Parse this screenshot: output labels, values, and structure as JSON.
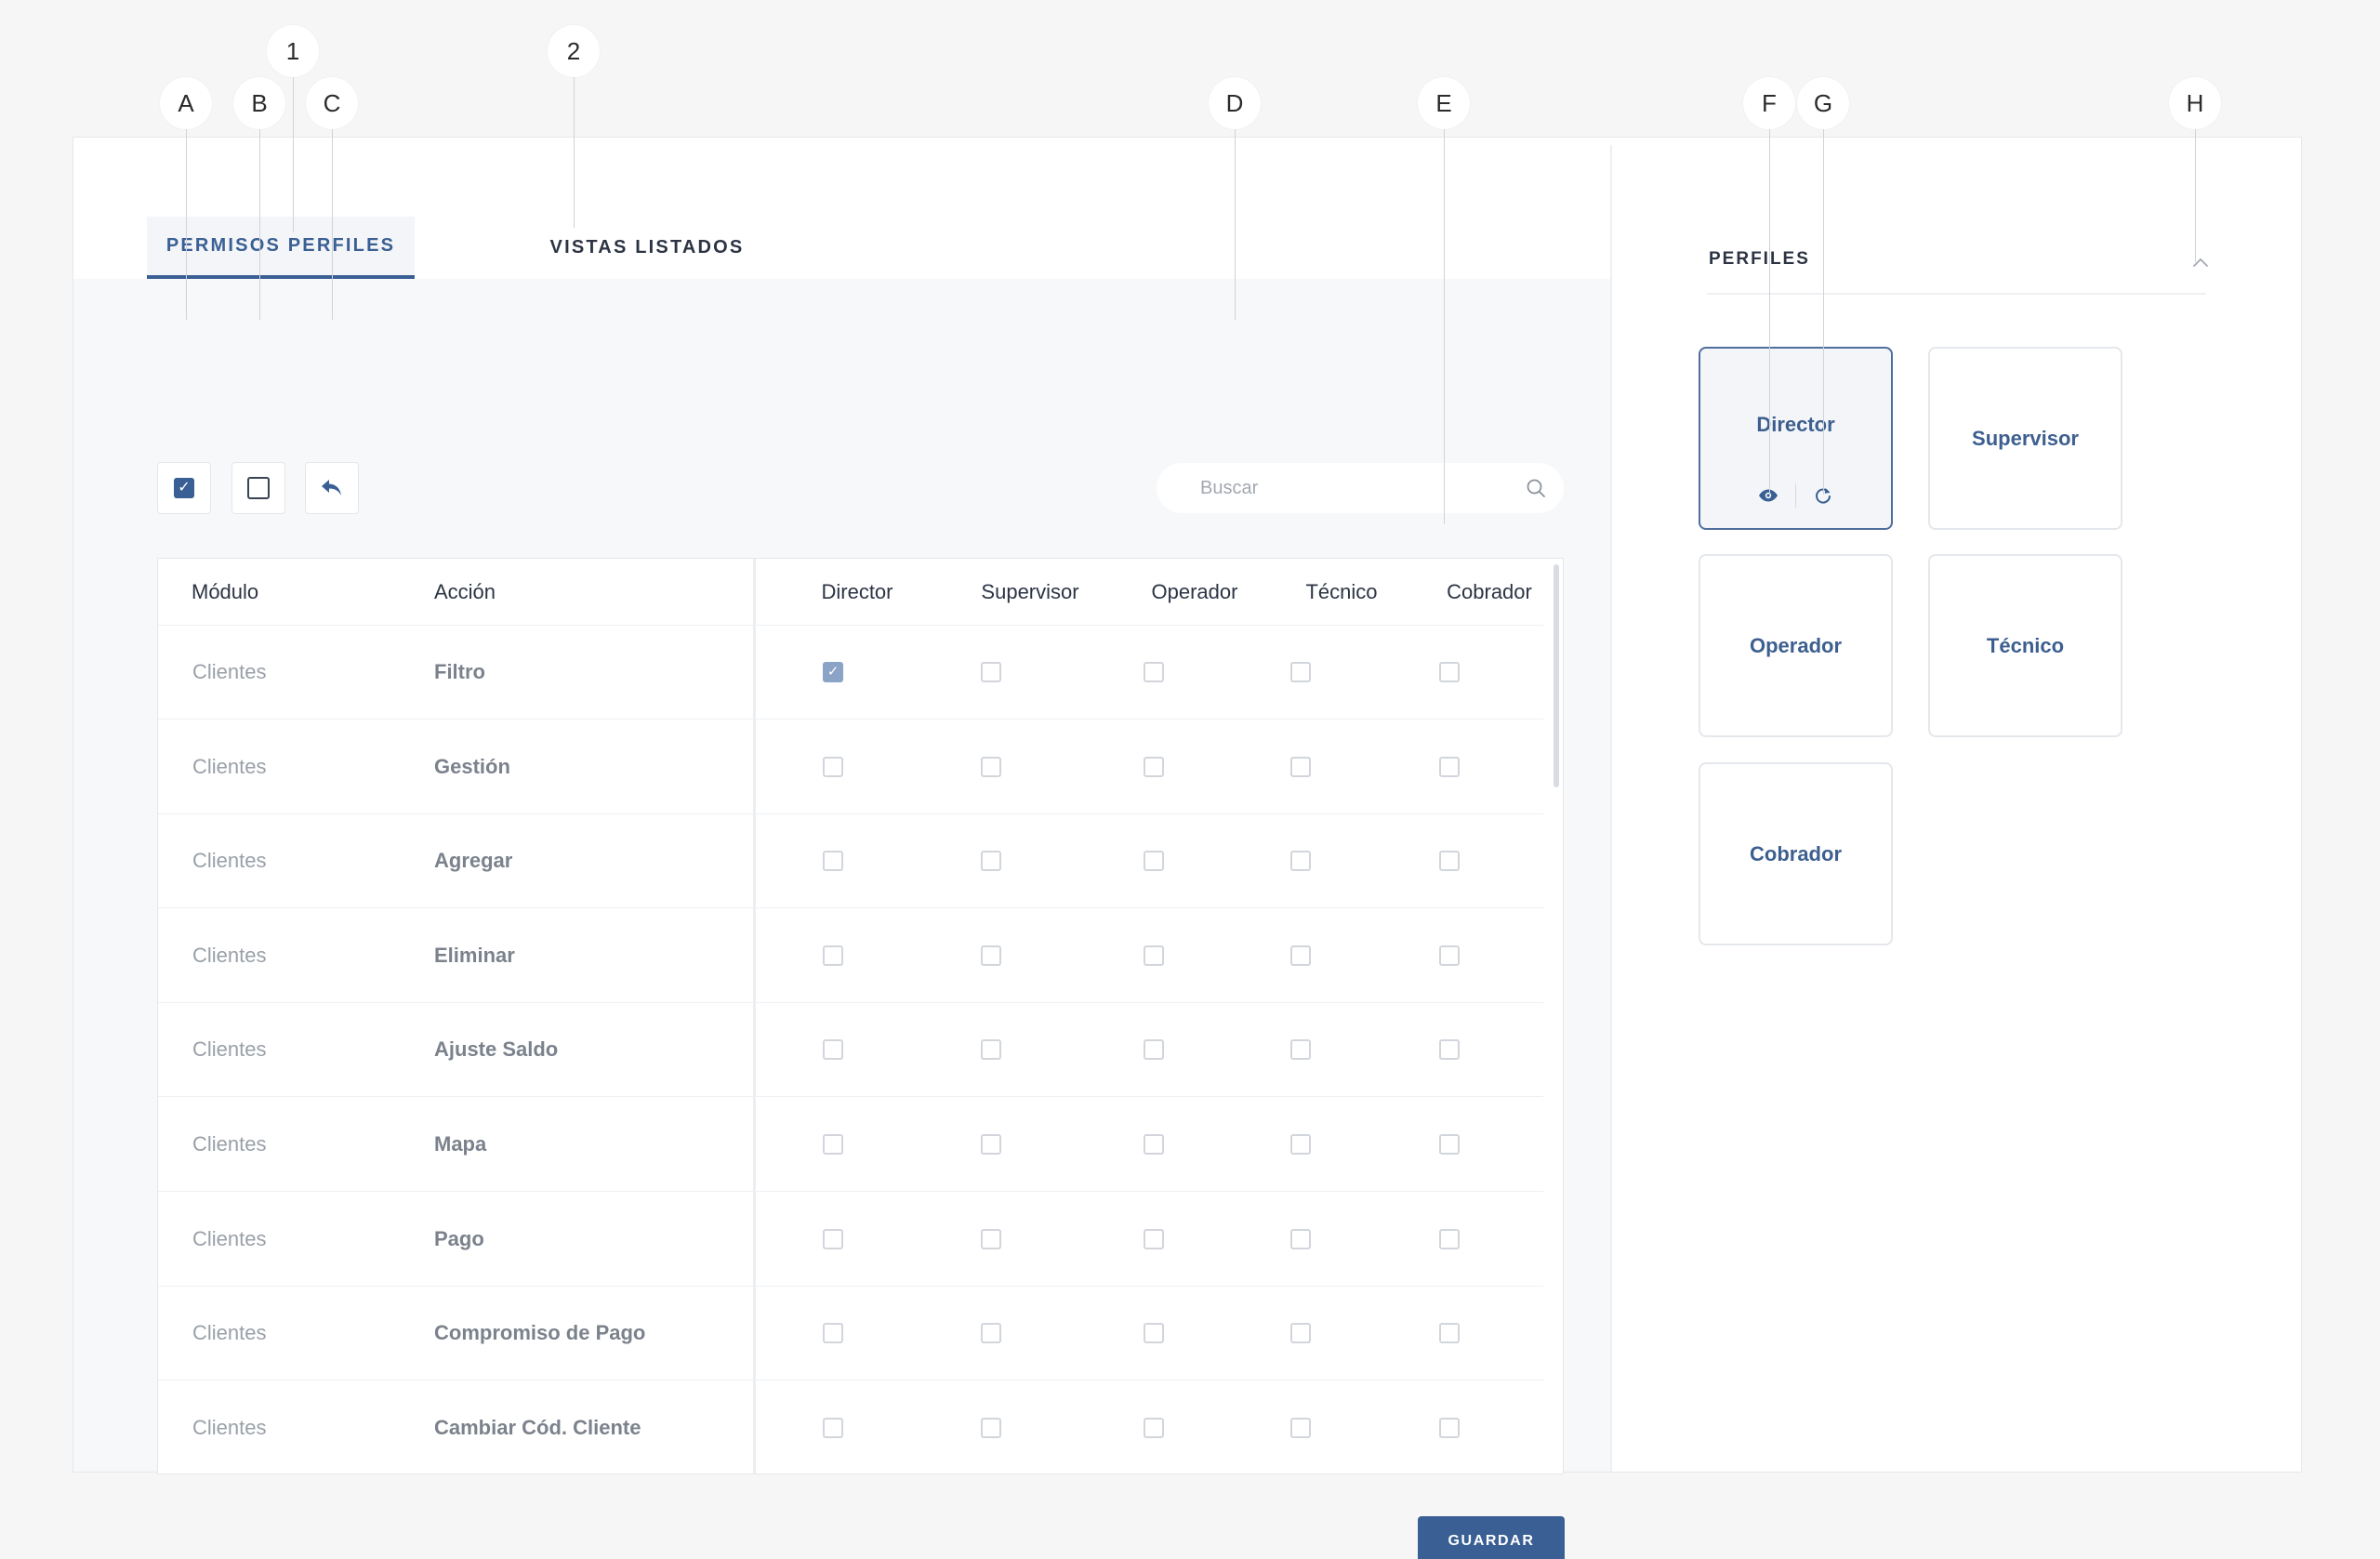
{
  "callouts": [
    "A",
    "B",
    "C",
    "D",
    "E",
    "F",
    "G",
    "H",
    "1",
    "2"
  ],
  "tabs": [
    {
      "label": "PERMISOS PERFILES",
      "active": true
    },
    {
      "label": "VISTAS LISTADOS",
      "active": false
    }
  ],
  "toolbar": {
    "select_all_icon": "checked-checkbox-icon",
    "deselect_all_icon": "empty-checkbox-icon",
    "undo_icon": "reply-arrow-icon"
  },
  "search": {
    "placeholder": "Buscar",
    "value": "",
    "icon": "search-icon"
  },
  "table": {
    "headers": {
      "module": "Módulo",
      "action": "Acción",
      "profiles": [
        "Director",
        "Supervisor",
        "Operador",
        "Técnico",
        "Cobrador"
      ]
    },
    "rows": [
      {
        "module": "Clientes",
        "action": "Filtro",
        "perms": [
          true,
          false,
          false,
          false,
          false
        ]
      },
      {
        "module": "Clientes",
        "action": "Gestión",
        "perms": [
          false,
          false,
          false,
          false,
          false
        ]
      },
      {
        "module": "Clientes",
        "action": "Agregar",
        "perms": [
          false,
          false,
          false,
          false,
          false
        ]
      },
      {
        "module": "Clientes",
        "action": "Eliminar",
        "perms": [
          false,
          false,
          false,
          false,
          false
        ]
      },
      {
        "module": "Clientes",
        "action": "Ajuste Saldo",
        "perms": [
          false,
          false,
          false,
          false,
          false
        ]
      },
      {
        "module": "Clientes",
        "action": "Mapa",
        "perms": [
          false,
          false,
          false,
          false,
          false
        ]
      },
      {
        "module": "Clientes",
        "action": "Pago",
        "perms": [
          false,
          false,
          false,
          false,
          false
        ]
      },
      {
        "module": "Clientes",
        "action": "Compromiso de Pago",
        "perms": [
          false,
          false,
          false,
          false,
          false
        ]
      },
      {
        "module": "Clientes",
        "action": "Cambiar Cód. Cliente",
        "perms": [
          false,
          false,
          false,
          false,
          false
        ]
      }
    ]
  },
  "save_label": "GUARDAR",
  "profiles_panel": {
    "title": "PERFILES",
    "collapse_icon": "chevron-up-icon",
    "cards": [
      {
        "name": "Director",
        "active": true,
        "actions": [
          "eye-icon",
          "refresh-icon"
        ]
      },
      {
        "name": "Supervisor",
        "active": false
      },
      {
        "name": "Operador",
        "active": false
      },
      {
        "name": "Técnico",
        "active": false
      },
      {
        "name": "Cobrador",
        "active": false
      }
    ]
  },
  "colors": {
    "accent": "#3a5f94",
    "background": "#f6f6f6",
    "table_bg": "#f7f8fa",
    "checked_light": "#8aa3c6"
  }
}
